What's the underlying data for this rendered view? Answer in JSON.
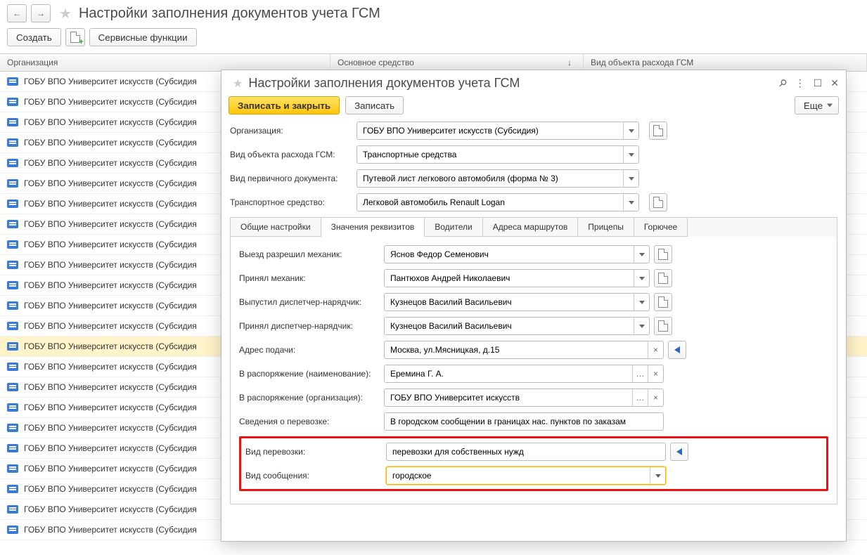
{
  "outer": {
    "title": "Настройки заполнения документов учета ГСМ",
    "create": "Создать",
    "service": "Сервисные функции",
    "columns": {
      "org": "Организация",
      "os": "Основное средство",
      "kind": "Вид объекта расхода ГСМ"
    },
    "sort_indicator": "↓",
    "row_text": "ГОБУ ВПО Университет искусств (Субсидия",
    "row_count": 23,
    "selected_index": 13
  },
  "dialog": {
    "title": "Настройки заполнения документов учета ГСМ",
    "more": "Еще",
    "save_close": "Записать и закрыть",
    "save": "Записать",
    "fields": {
      "org_label": "Организация:",
      "org_value": "ГОБУ ВПО Университет искусств (Субсидия)",
      "kind_label": "Вид объекта расхода ГСМ:",
      "kind_value": "Транспортные средства",
      "doc_label": "Вид первичного документа:",
      "doc_value": "Путевой лист легкового автомобиля (форма № 3)",
      "vehicle_label": "Транспортное средство:",
      "vehicle_value": "Легковой автомобиль Renault Logan"
    },
    "tabs": [
      "Общие настройки",
      "Значения реквизитов",
      "Водители",
      "Адреса маршрутов",
      "Прицепы",
      "Горючее"
    ],
    "active_tab": 1,
    "panel": {
      "mechanic_out_label": "Выезд разрешил механик:",
      "mechanic_out_value": "Яснов Федор Семенович",
      "mechanic_in_label": "Принял механик:",
      "mechanic_in_value": "Пантюхов Андрей Николаевич",
      "dispatcher_out_label": "Выпустил диспетчер-нарядчик:",
      "dispatcher_out_value": "Кузнецов Василий Васильевич",
      "dispatcher_in_label": "Принял диспетчер-нарядчик:",
      "dispatcher_in_value": "Кузнецов Василий Васильевич",
      "address_label": "Адрес подачи:",
      "address_value": "Москва, ул.Мясницкая, д.15",
      "order_name_label": "В распоряжение (наименование):",
      "order_name_value": "Еремина Г. А.",
      "order_org_label": "В распоряжение (организация):",
      "order_org_value": "ГОБУ ВПО Университет искусств",
      "transport_info_label": "Сведения о перевозке:",
      "transport_info_value": "В городском сообщении в границах нас. пунктов по заказам",
      "transport_kind_label": "Вид перевозки:",
      "transport_kind_value": "перевозки для собственных нужд",
      "message_kind_label": "Вид сообщения:",
      "message_kind_value": "городское"
    }
  }
}
